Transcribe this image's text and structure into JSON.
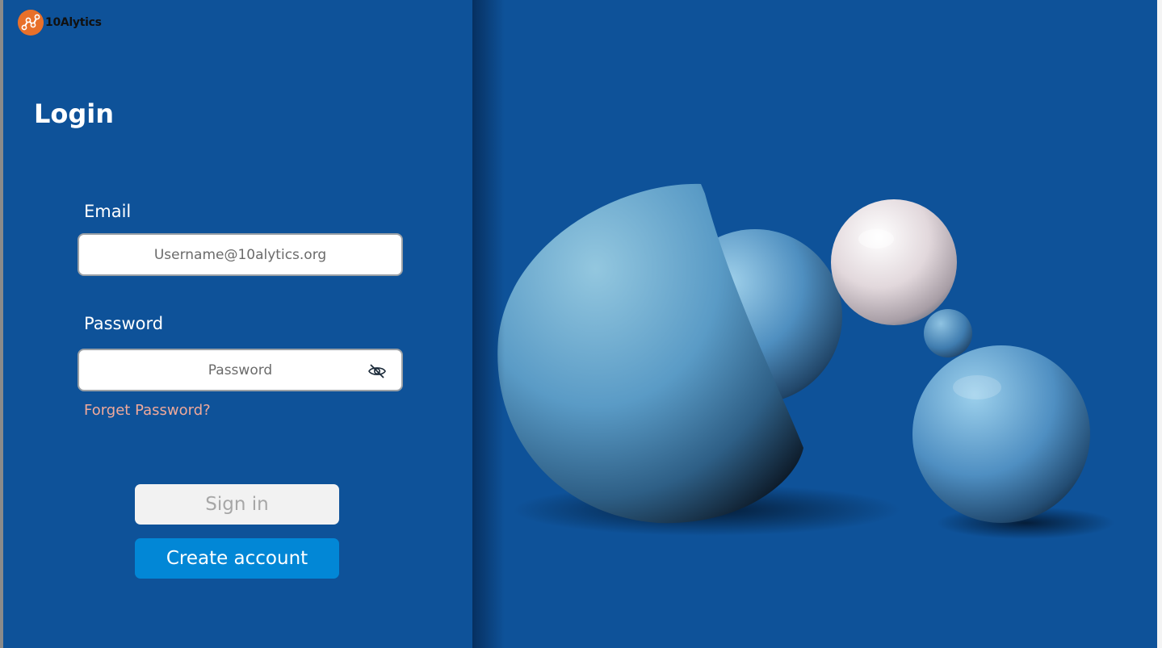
{
  "brand": {
    "name": "10Alytics",
    "logo_icon": "analytics-nodes-icon",
    "accent_color": "#e8702a"
  },
  "login": {
    "title": "Login",
    "email_label": "Email",
    "email_placeholder": "Username@10alytics.org",
    "password_label": "Password",
    "password_placeholder": "Password",
    "password_toggle_icon": "eye-off-icon",
    "forgot_link": "Forget Password?",
    "signin_label": "Sign in",
    "create_label": "Create account"
  },
  "colors": {
    "background": "#0e5299",
    "signin_bg": "#f2f2f2",
    "create_bg": "#0287d6",
    "forgot_link": "#f0a99a"
  },
  "hero": {
    "illustration": "3d-spheres-illustration"
  }
}
